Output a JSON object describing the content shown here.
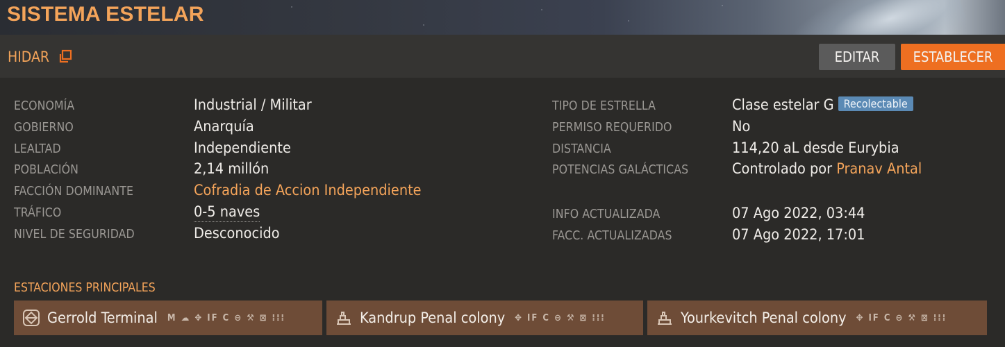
{
  "header": {
    "title": "SISTEMA ESTELAR"
  },
  "system": {
    "name": "HIDAR",
    "external_icon": "external-link-icon"
  },
  "toolbar": {
    "edit_label": "EDITAR",
    "set_label": "ESTABLECER"
  },
  "colors": {
    "accent": "#f4a45a",
    "primary_button": "#ee6f21",
    "secondary_button": "#5b5b5b",
    "badge": "#5b8ab5",
    "station_card": "#6e4c37"
  },
  "info_left": {
    "economy": {
      "label": "ECONOMÍA",
      "value": "Industrial / Militar"
    },
    "government": {
      "label": "GOBIERNO",
      "value": "Anarquía"
    },
    "allegiance": {
      "label": "LEALTAD",
      "value": "Independiente"
    },
    "population": {
      "label": "POBLACIÓN",
      "value": "2,14 millón"
    },
    "faction": {
      "label": "FACCIÓN DOMINANTE",
      "value": "Cofradia de Accion Independiente"
    },
    "traffic": {
      "label": "TRÁFICO",
      "value": "0-5 naves"
    },
    "security": {
      "label": "NIVEL DE SEGURIDAD",
      "value": "Desconocido"
    }
  },
  "info_right": {
    "star_type": {
      "label": "TIPO DE ESTRELLA",
      "value": "Clase estelar G",
      "badge": "Recolectable"
    },
    "permit": {
      "label": "PERMISO REQUERIDO",
      "value": "No"
    },
    "distance": {
      "label": "DISTANCIA",
      "value": "114,20 aL desde Eurybia"
    },
    "powers": {
      "label": "POTENCIAS GALÁCTICAS",
      "prefix": "Controlado por",
      "value": "Pranav Antal"
    },
    "info_updated": {
      "label": "INFO ACTUALIZADA",
      "value": "07 Ago 2022, 03:44"
    },
    "factions_updated": {
      "label": "FACC. ACTUALIZADAS",
      "value": "07 Ago 2022, 17:01"
    }
  },
  "stations": {
    "title": "ESTACIONES PRINCIPALES",
    "items": [
      {
        "name": "Gerrold Terminal",
        "icon": "outpost-icon",
        "services": "M ☁ ✥ IF C ⊖ ⚒ ⊠ ⁞⁞⁞"
      },
      {
        "name": "Kandrup Penal colony",
        "icon": "settlement-icon",
        "services": "✥ IF C ⊖ ⚒ ⊠ ⁞⁞⁞"
      },
      {
        "name": "Yourkevitch Penal colony",
        "icon": "settlement-icon",
        "services": "✥ IF C ⊖ ⚒ ⊠ ⁞⁞⁞"
      }
    ]
  }
}
